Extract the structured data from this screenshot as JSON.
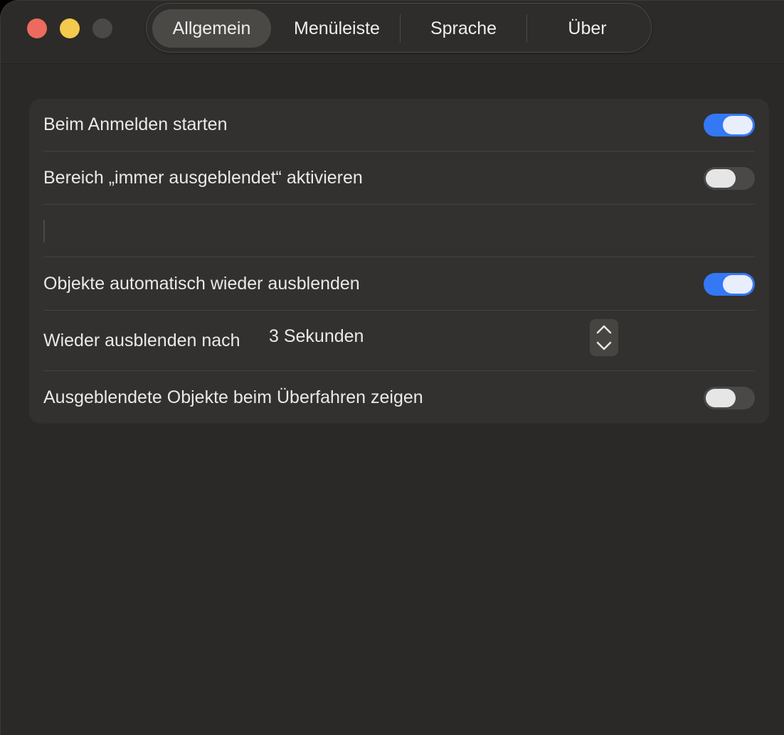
{
  "window": {
    "traffic_lights": {
      "close_color": "#ed6a5e",
      "minimize_color": "#f5c94d",
      "zoom_color": "#4a4947"
    }
  },
  "tabs": [
    {
      "label": "Allgemein",
      "active": true
    },
    {
      "label": "Menüleiste",
      "active": false
    },
    {
      "label": "Sprache",
      "active": false
    },
    {
      "label": "Über",
      "active": false
    }
  ],
  "settings": {
    "launch_at_login": {
      "label": "Beim Anmelden starten",
      "enabled": true
    },
    "always_hidden": {
      "label": "Bereich „immer ausgeblendet“ aktivieren",
      "enabled": false
    },
    "auto_rehide": {
      "label": "Objekte automatisch wieder ausblenden",
      "enabled": true
    },
    "rehide_after": {
      "label": "Wieder ausblenden nach",
      "value": "3 Sekunden"
    },
    "show_on_hover": {
      "label": "Ausgeblendete Objekte beim Überfahren zeigen",
      "enabled": false
    }
  },
  "colors": {
    "accent": "#3478f6",
    "window_bg": "#2a2927",
    "card_bg": "#32312f"
  }
}
